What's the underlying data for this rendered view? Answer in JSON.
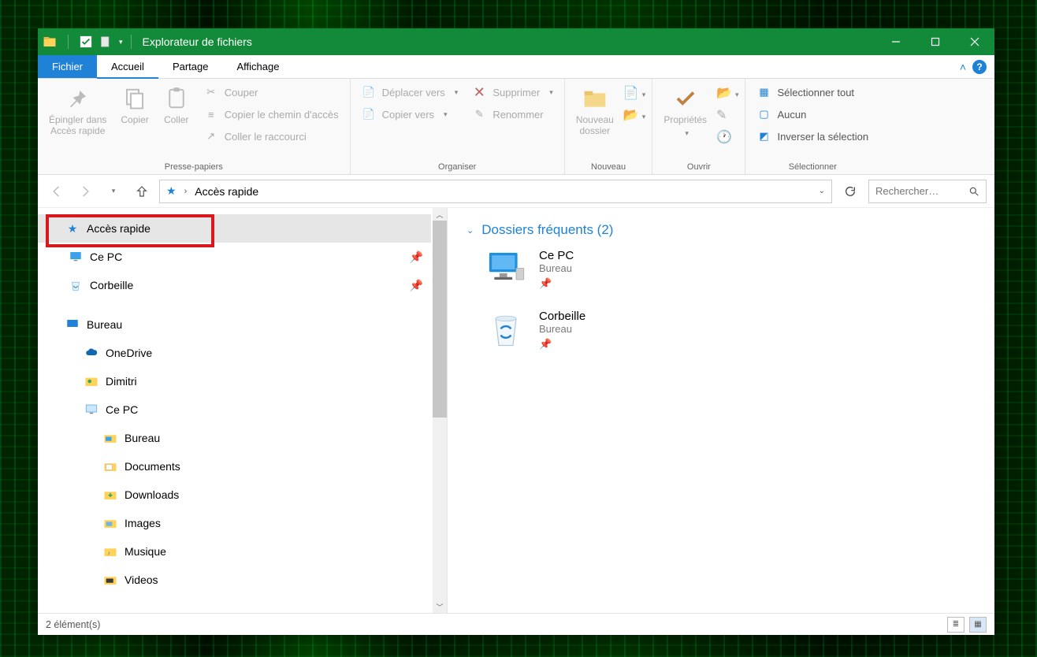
{
  "window": {
    "title": "Explorateur de fichiers"
  },
  "tabs": {
    "file": "Fichier",
    "home": "Accueil",
    "share": "Partage",
    "view": "Affichage"
  },
  "ribbon": {
    "clipboard": {
      "pin": "Épingler dans\nAccès rapide",
      "copy": "Copier",
      "paste": "Coller",
      "cut": "Couper",
      "copy_path": "Copier le chemin d'accès",
      "paste_shortcut": "Coller le raccourci",
      "label": "Presse-papiers"
    },
    "organize": {
      "move_to": "Déplacer vers",
      "copy_to": "Copier vers",
      "delete": "Supprimer",
      "rename": "Renommer",
      "label": "Organiser"
    },
    "new": {
      "new_folder": "Nouveau\ndossier",
      "label": "Nouveau"
    },
    "open": {
      "properties": "Propriétés",
      "label": "Ouvrir"
    },
    "select": {
      "select_all": "Sélectionner tout",
      "select_none": "Aucun",
      "invert": "Inverser la sélection",
      "label": "Sélectionner"
    }
  },
  "address": {
    "location": "Accès rapide"
  },
  "search": {
    "placeholder": "Rechercher…"
  },
  "tree": {
    "quick_access": "Accès rapide",
    "this_pc_pin": "Ce PC",
    "recycle_pin": "Corbeille",
    "desktop": "Bureau",
    "onedrive": "OneDrive",
    "user": "Dimitri",
    "this_pc": "Ce PC",
    "folders": {
      "desktop": "Bureau",
      "documents": "Documents",
      "downloads": "Downloads",
      "images": "Images",
      "music": "Musique",
      "videos": "Videos"
    }
  },
  "content": {
    "group_header": "Dossiers fréquents (2)",
    "items": [
      {
        "title": "Ce PC",
        "subtitle": "Bureau"
      },
      {
        "title": "Corbeille",
        "subtitle": "Bureau"
      }
    ]
  },
  "status": {
    "count_label": "2 élément(s)"
  }
}
